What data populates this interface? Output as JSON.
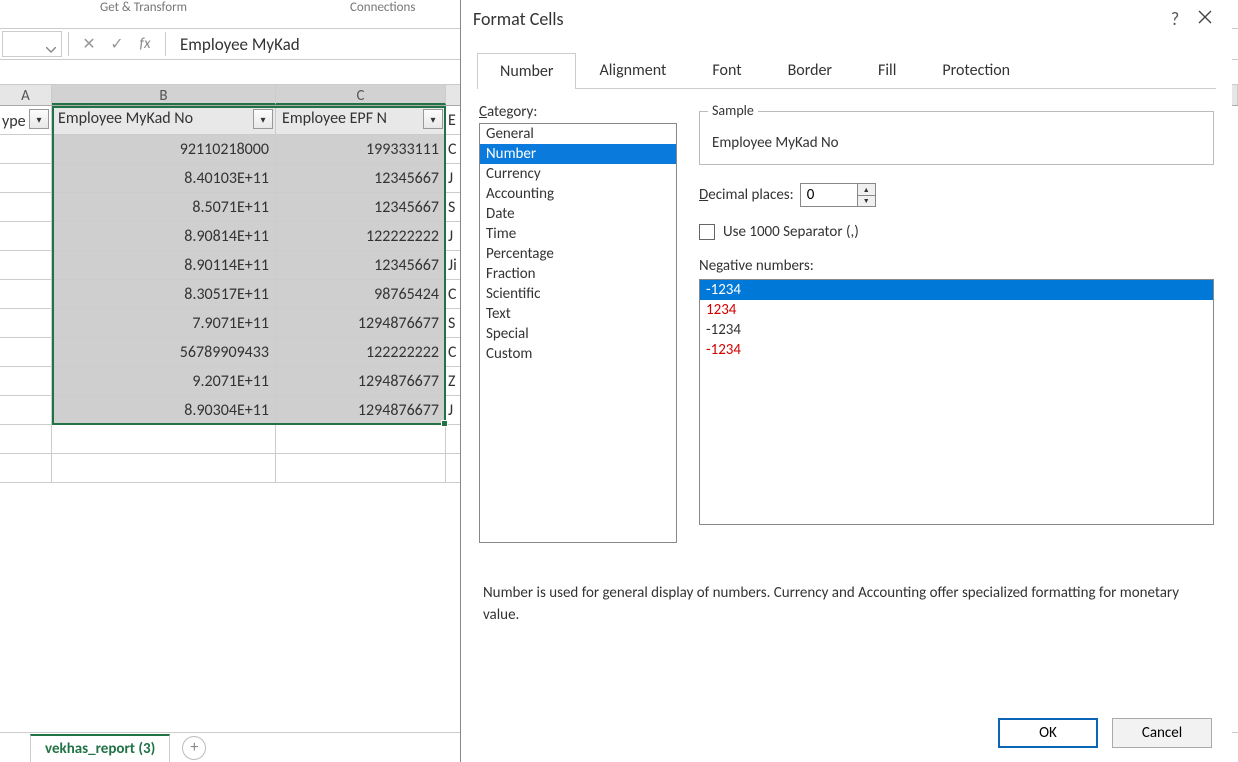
{
  "ribbon": {
    "group1": "Get & Transform",
    "group2": "Connections"
  },
  "formula_bar": {
    "name_box": "",
    "value": "Employee MyKad"
  },
  "columns": {
    "A": "A",
    "B": "B",
    "C": "C"
  },
  "table": {
    "headerA": "ype",
    "headerB": "Employee MyKad No",
    "headerC": "Employee EPF N",
    "headerD": "E",
    "rows": [
      {
        "b": "92110218000",
        "c": "199333111",
        "d": "C"
      },
      {
        "b": "8.40103E+11",
        "c": "12345667",
        "d": "J"
      },
      {
        "b": "8.5071E+11",
        "c": "12345667",
        "d": "S"
      },
      {
        "b": "8.90814E+11",
        "c": "122222222",
        "d": "J"
      },
      {
        "b": "8.90114E+11",
        "c": "12345667",
        "d": "Ji"
      },
      {
        "b": "8.30517E+11",
        "c": "98765424",
        "d": "C"
      },
      {
        "b": "7.9071E+11",
        "c": "1294876677",
        "d": "S"
      },
      {
        "b": "56789909433",
        "c": "122222222",
        "d": "C"
      },
      {
        "b": "9.2071E+11",
        "c": "1294876677",
        "d": "Z"
      },
      {
        "b": "8.90304E+11",
        "c": "1294876677",
        "d": "J"
      }
    ]
  },
  "sheet_tab": {
    "name": "vekhas_report (3)"
  },
  "dialog": {
    "title": "Format Cells",
    "help": "?",
    "tabs": [
      "Number",
      "Alignment",
      "Font",
      "Border",
      "Fill",
      "Protection"
    ],
    "active_tab": "Number",
    "category_label": "Category:",
    "categories": [
      "General",
      "Number",
      "Currency",
      "Accounting",
      "Date",
      "Time",
      "Percentage",
      "Fraction",
      "Scientific",
      "Text",
      "Special",
      "Custom"
    ],
    "selected_category": "Number",
    "sample_label": "Sample",
    "sample_value": "Employee MyKad No",
    "decimal_label_pre": "D",
    "decimal_label_post": "ecimal places:",
    "decimal_value": "0",
    "separator_label_pre": "U",
    "separator_label_post": "se 1000 Separator (,)",
    "negative_label_pre": "N",
    "negative_label_post": "egative numbers:",
    "negative_options": [
      {
        "text": "-1234",
        "red": false,
        "selected": true
      },
      {
        "text": "1234",
        "red": true,
        "selected": false
      },
      {
        "text": "-1234",
        "red": false,
        "selected": false
      },
      {
        "text": "-1234",
        "red": true,
        "selected": false
      }
    ],
    "description": "Number is used for general display of numbers.  Currency and Accounting offer specialized formatting for monetary value.",
    "ok": "OK",
    "cancel": "Cancel"
  }
}
